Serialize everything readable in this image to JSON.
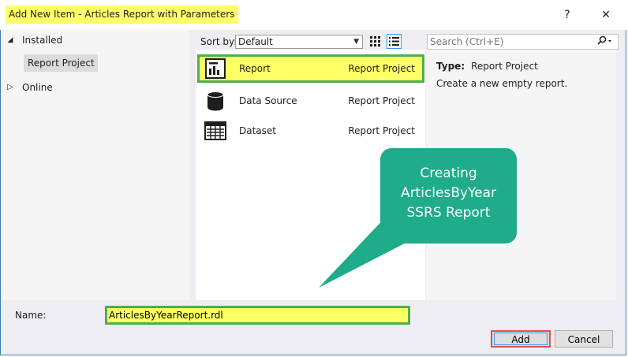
{
  "window": {
    "title": "Add New Item - Articles Report with Parameters",
    "help_label": "?",
    "close_label": "✕"
  },
  "tree": {
    "installed": "Installed",
    "report_project": "Report Project",
    "online": "Online"
  },
  "toolbar": {
    "sort_label": "Sort by:",
    "sort_value": "Default"
  },
  "search": {
    "placeholder": "Search (Ctrl+E)"
  },
  "items": [
    {
      "name": "Report",
      "type": "Report Project",
      "icon": "report-icon"
    },
    {
      "name": "Data Source",
      "type": "Report Project",
      "icon": "database-icon"
    },
    {
      "name": "Dataset",
      "type": "Report Project",
      "icon": "dataset-grid-icon"
    }
  ],
  "details": {
    "type_label": "Type:",
    "type_value": "Report Project",
    "description": "Create a new empty report."
  },
  "callout": {
    "line1": "Creating",
    "line2": "ArticlesByYear",
    "line3": "SSRS Report"
  },
  "form": {
    "name_label": "Name:",
    "name_value": "ArticlesByYearReport.rdl",
    "add_label": "Add",
    "cancel_label": "Cancel"
  },
  "colors": {
    "highlight": "#ffff66",
    "green_outline": "#4caf50",
    "red_outline": "#ea4c4c",
    "callout": "#1fac8a"
  }
}
